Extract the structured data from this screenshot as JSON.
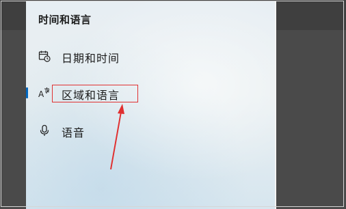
{
  "settings_nav": {
    "section_title": "时间和语言",
    "items": [
      {
        "label": "日期和时间",
        "icon": "calendar-clock-icon"
      },
      {
        "label": "区域和语言",
        "icon": "language-icon",
        "selected": true
      },
      {
        "label": "语音",
        "icon": "microphone-icon"
      }
    ]
  },
  "annotation": {
    "color": "#e03030"
  },
  "accent_color": "#0067c0"
}
